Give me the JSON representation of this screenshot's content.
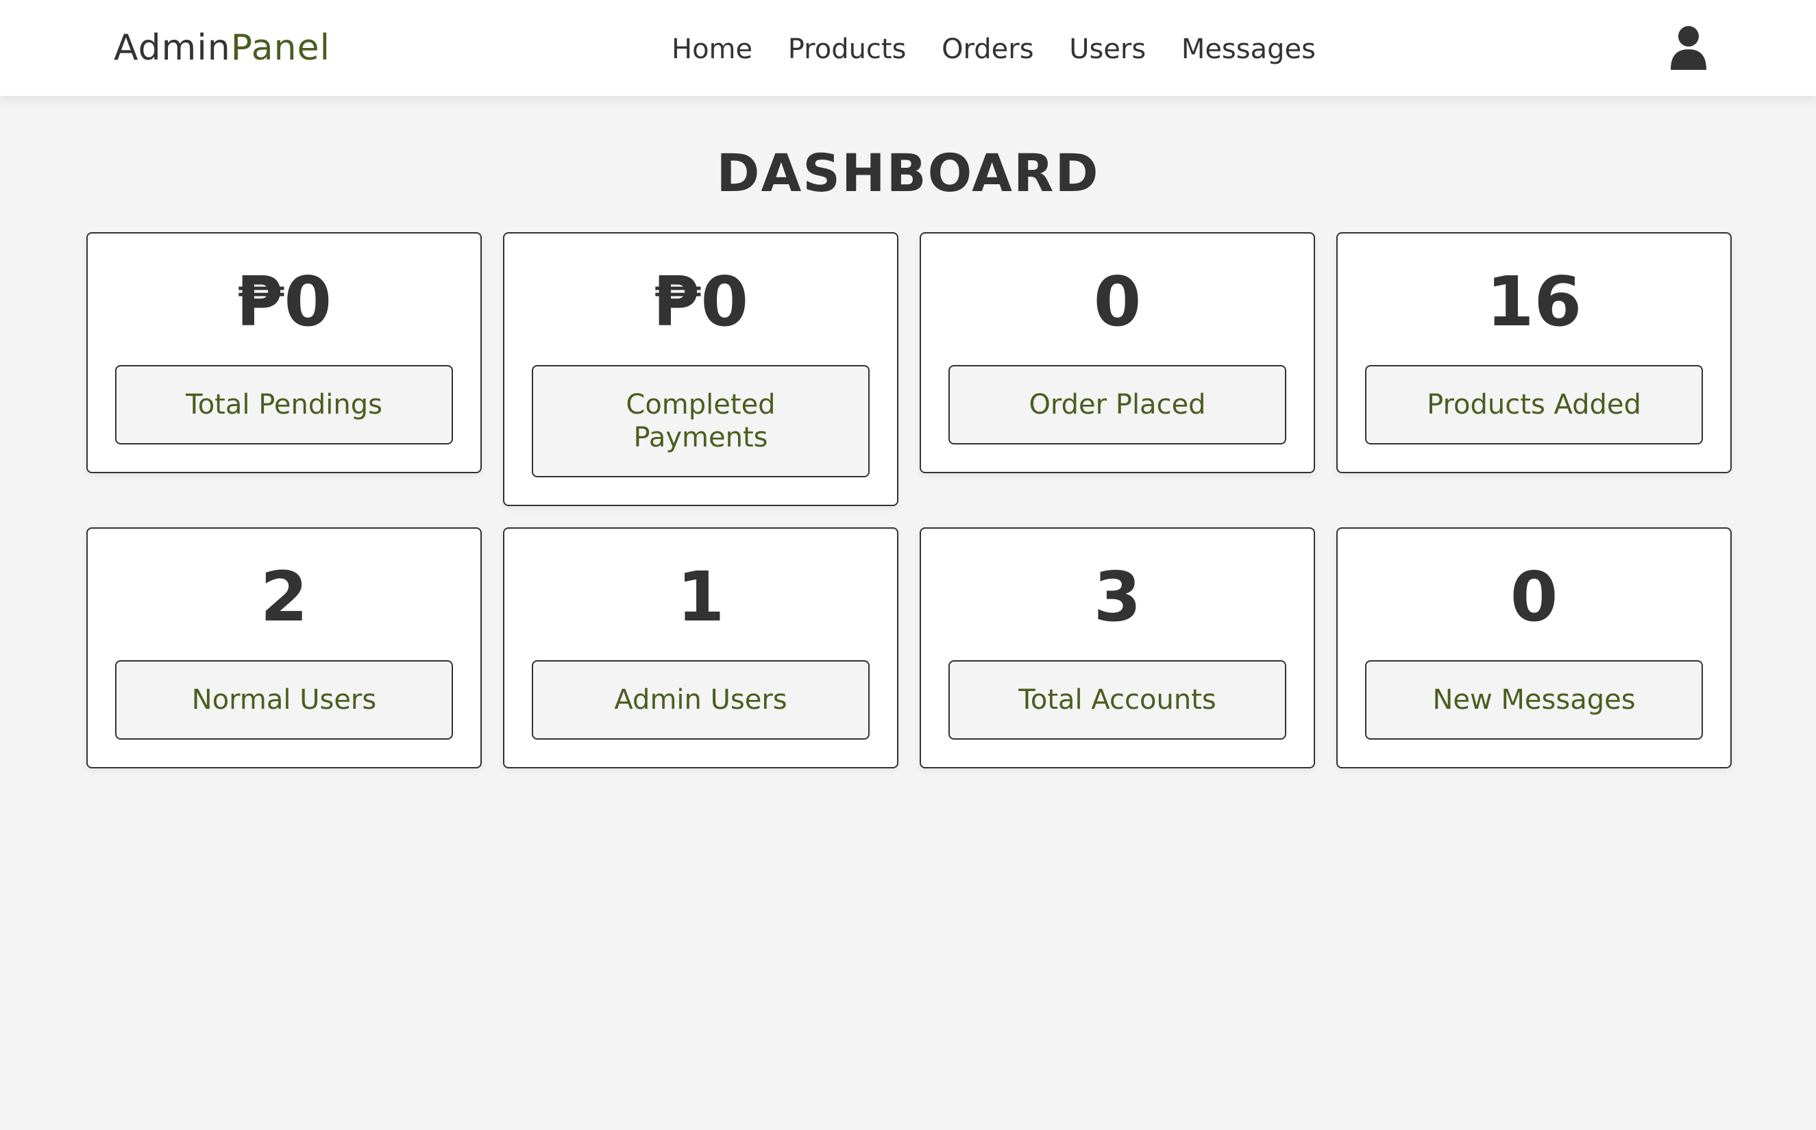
{
  "header": {
    "logo": {
      "part1": "Admin",
      "part2": "Panel"
    },
    "nav": [
      "Home",
      "Products",
      "Orders",
      "Users",
      "Messages"
    ],
    "user_icon": "user-icon"
  },
  "main": {
    "title": "DASHBOARD",
    "cards": [
      {
        "value": "₱0",
        "label": "Total Pendings"
      },
      {
        "value": "₱0",
        "label": "Completed Payments"
      },
      {
        "value": "0",
        "label": "Order Placed"
      },
      {
        "value": "16",
        "label": "Products Added"
      },
      {
        "value": "2",
        "label": "Normal Users"
      },
      {
        "value": "1",
        "label": "Admin Users"
      },
      {
        "value": "3",
        "label": "Total Accounts"
      },
      {
        "value": "0",
        "label": "New Messages"
      }
    ]
  },
  "colors": {
    "accent": "#4a5e1f",
    "text": "#333333",
    "background": "#f4f4f4",
    "card": "#ffffff"
  }
}
